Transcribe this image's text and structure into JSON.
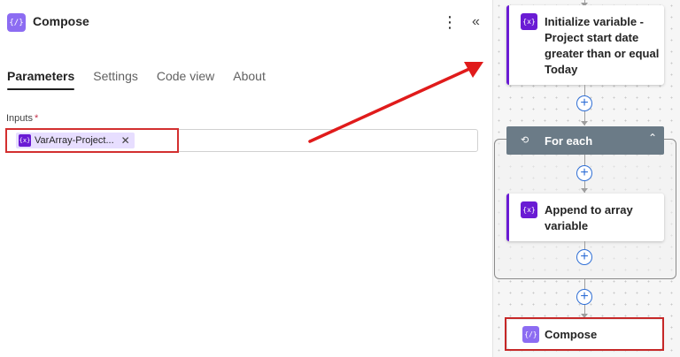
{
  "panel": {
    "title": "Compose",
    "title_icon": "{/}",
    "more_icon": "⋮",
    "collapse_icon": "«",
    "tabs": [
      {
        "label": "Parameters",
        "active": true
      },
      {
        "label": "Settings",
        "active": false
      },
      {
        "label": "Code view",
        "active": false
      },
      {
        "label": "About",
        "active": false
      }
    ],
    "inputs": {
      "label": "Inputs",
      "required_marker": "*",
      "token_icon": "{x}",
      "token_label": "VarArray-Project...",
      "token_remove": "✕"
    }
  },
  "canvas": {
    "plus_symbol": "+",
    "init_card": {
      "icon": "{x}",
      "title": "Initialize variable - Project start date greater than or equal Today"
    },
    "foreach": {
      "icon": "⟲",
      "title": "For each",
      "chevron": "⌃"
    },
    "append_card": {
      "icon": "{x}",
      "title": "Append to array variable"
    },
    "compose_card": {
      "icon": "{/}",
      "title": "Compose"
    }
  },
  "colors": {
    "accent_purple": "#6a1bd4",
    "compose_purple": "#8c6cf2",
    "highlight_red": "#d32f2f",
    "foreach_header": "#6b7b87",
    "plus_blue": "#2f6fd6"
  }
}
